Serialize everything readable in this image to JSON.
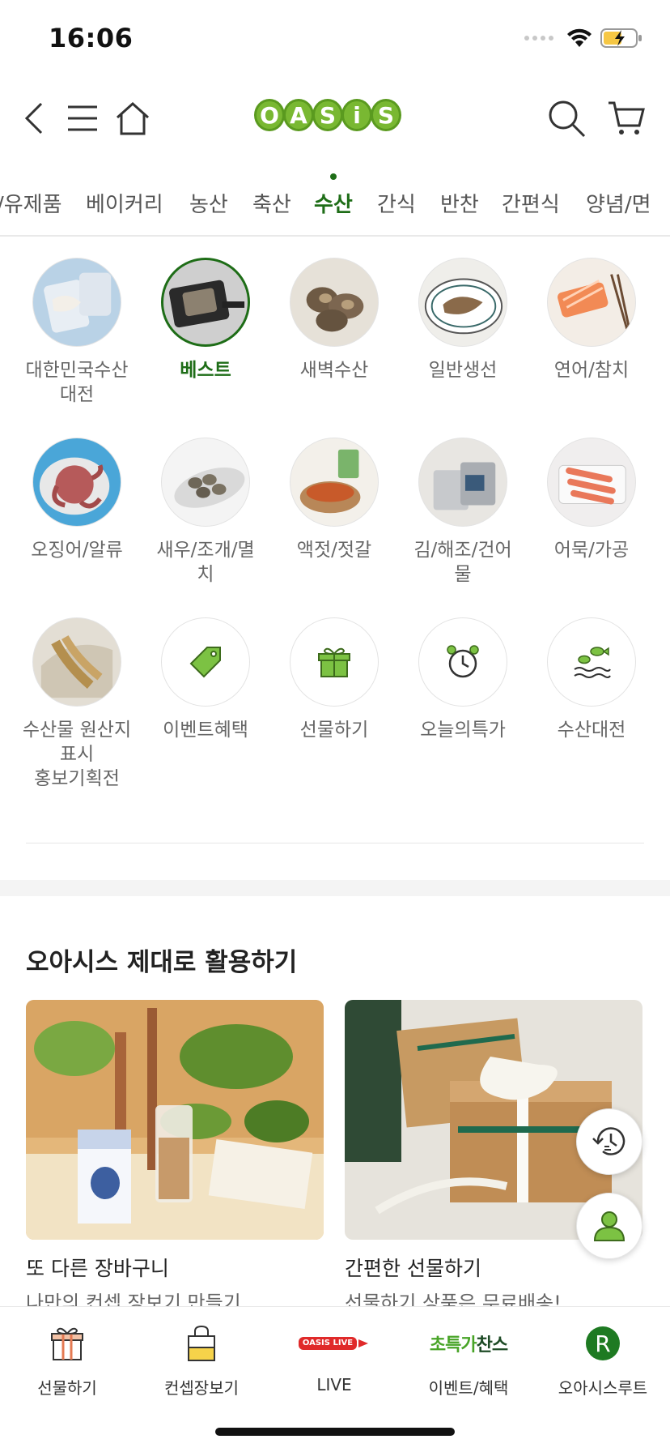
{
  "status": {
    "time": "16:06"
  },
  "header": {
    "logo": [
      "O",
      "A",
      "S",
      "i",
      "S"
    ]
  },
  "category_tabs": [
    {
      "label": "/유제품"
    },
    {
      "label": "베이커리"
    },
    {
      "label": "농산"
    },
    {
      "label": "축산"
    },
    {
      "label": "수산",
      "active": true
    },
    {
      "label": "간식"
    },
    {
      "label": "반찬"
    },
    {
      "label": "간편식"
    },
    {
      "label": "양념/면"
    }
  ],
  "subcategories": [
    {
      "label": "대한민국수산\n대전"
    },
    {
      "label": "베스트",
      "selected": true
    },
    {
      "label": "새벽수산"
    },
    {
      "label": "일반생선"
    },
    {
      "label": "연어/참치"
    },
    {
      "label": "오징어/알류"
    },
    {
      "label": "새우/조개/멸\n치"
    },
    {
      "label": "액젓/젓갈"
    },
    {
      "label": "김/해조/건어\n물"
    },
    {
      "label": "어묵/가공"
    },
    {
      "label": "수산물 원산지\n표시\n홍보기획전"
    },
    {
      "label": "이벤트혜택",
      "icon": "price-tag-icon"
    },
    {
      "label": "선물하기",
      "icon": "gift-icon"
    },
    {
      "label": "오늘의특가",
      "icon": "alarm-clock-icon"
    },
    {
      "label": "수산대전",
      "icon": "fish-waves-icon"
    }
  ],
  "section": {
    "title": "오아시스 제대로 활용하기"
  },
  "cards": [
    {
      "title": "또 다른 장바구니",
      "subtitle": "나만의 컨셉 장보기 만들기"
    },
    {
      "title": "간편한 선물하기",
      "subtitle": "선물하기 상품은 무료배송!"
    }
  ],
  "bottom_nav": [
    {
      "label": "선물하기",
      "icon": "gift-icon"
    },
    {
      "label": "컨셉장보기",
      "icon": "shopping-bag-icon"
    },
    {
      "label": "LIVE",
      "icon": "oasis-live-icon",
      "badge": "OASIS LIVE"
    },
    {
      "label": "이벤트/혜택",
      "icon": "super-deal-chance-icon",
      "badge_green": "초특가",
      "badge_dark": "찬스"
    },
    {
      "label": "오아시스루트",
      "icon": "route-r-icon",
      "badge": "R"
    }
  ],
  "colors": {
    "brand_green": "#1e6d17",
    "logo_green": "#79b832",
    "battery_yellow": "#f6c744"
  }
}
